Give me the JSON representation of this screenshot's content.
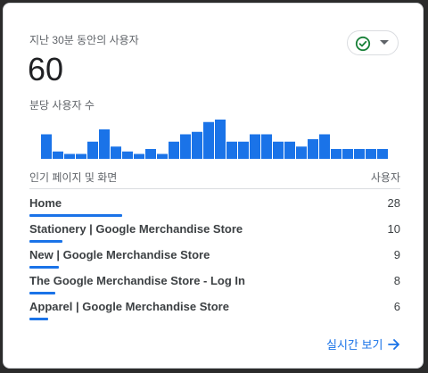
{
  "card": {
    "title": "지난 30분 동안의 사용자",
    "total": "60",
    "subtitle": "분당 사용자 수",
    "status_icon": "check-circle-icon",
    "dropdown_icon": "caret-down-icon",
    "accent_color": "#1a73e8",
    "status_color": "#188038"
  },
  "chart_data": {
    "type": "bar",
    "values": [
      10,
      3,
      2,
      2,
      7,
      12,
      5,
      3,
      2,
      4,
      2,
      7,
      10,
      11,
      15,
      16,
      7,
      7,
      10,
      10,
      7,
      7,
      5,
      8,
      10,
      4,
      4,
      4,
      4,
      4
    ],
    "ylim": [
      0,
      16
    ],
    "grid": false
  },
  "table": {
    "header_page": "인기 페이지 및 화면",
    "header_users": "사용자",
    "rows": [
      {
        "name": "Home",
        "value": "28",
        "share": 0.25
      },
      {
        "name": "Stationery | Google Merchandise Store",
        "value": "10",
        "share": 0.09
      },
      {
        "name": "New | Google Merchandise Store",
        "value": "9",
        "share": 0.08
      },
      {
        "name": "The Google Merchandise Store - Log In",
        "value": "8",
        "share": 0.07
      },
      {
        "name": "Apparel | Google Merchandise Store",
        "value": "6",
        "share": 0.05
      }
    ]
  },
  "footer": {
    "link_label": "실시간 보기",
    "link_icon": "arrow-right-icon"
  }
}
